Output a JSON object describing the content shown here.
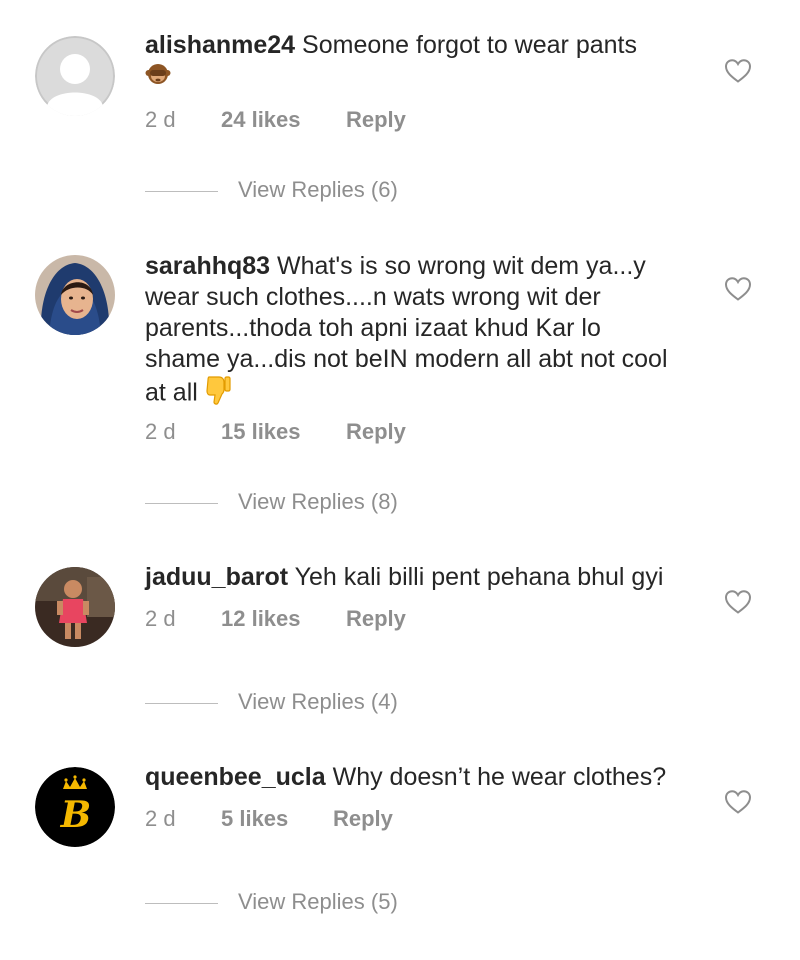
{
  "comments": [
    {
      "username": "alishanme24",
      "text": "Someone forgot to wear pants",
      "emoji": "see-no-evil-monkey",
      "time": "2 d",
      "likes": "24 likes",
      "reply": "Reply",
      "view_replies": "View Replies (6)",
      "avatar": "default-avatar"
    },
    {
      "username": "sarahhq83",
      "text": "What's is so wrong wit dem ya...y wear such clothes....n wats wrong wit der parents...thoda toh apni izaat khud Kar lo shame ya...dis not beIN modern all abt not cool at all",
      "emoji": "thumbs-down",
      "time": "2 d",
      "likes": "15 likes",
      "reply": "Reply",
      "view_replies": "View Replies (8)",
      "avatar": "woman-hijab-photo"
    },
    {
      "username": "jaduu_barot",
      "text": "Yeh kali billi pent pehana bhul gyi",
      "time": "2 d",
      "likes": "12 likes",
      "reply": "Reply",
      "view_replies": "View Replies (4)",
      "avatar": "child-photo"
    },
    {
      "username": "queenbee_ucla",
      "text": "Why doesn’t he wear clothes?",
      "time": "2 d",
      "likes": "5 likes",
      "reply": "Reply",
      "view_replies": "View Replies (5)",
      "avatar": "crown-b-logo"
    }
  ],
  "colors": {
    "text": "#262626",
    "meta": "#8e8e8e",
    "divider": "#bdbdbd",
    "heart_outline": "#8e8e8e",
    "logo_gold": "#f5b800"
  }
}
